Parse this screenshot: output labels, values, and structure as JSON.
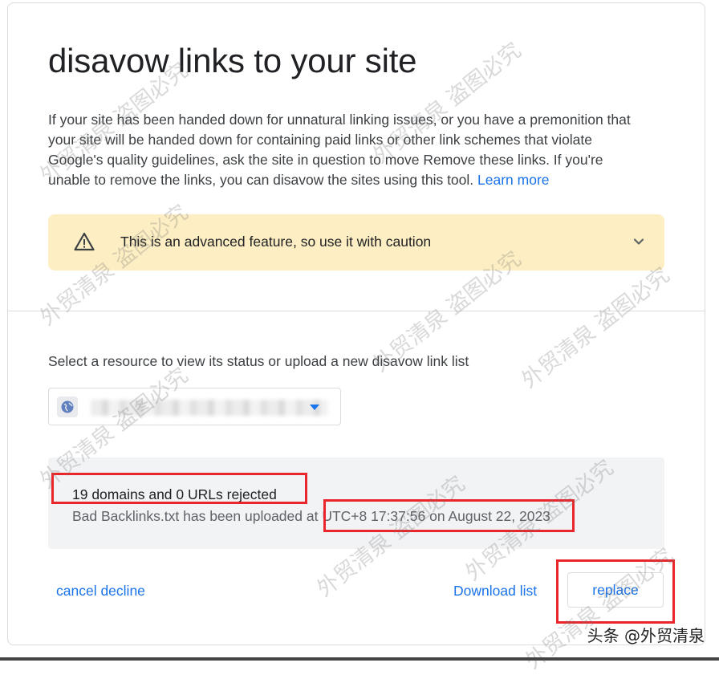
{
  "page": {
    "title": "disavow links to your site",
    "intro": "If your site has been handed down for unnatural linking issues, or you have a premonition that your site will be handed down for containing paid links or other link schemes that violate Google's quality guidelines, ask the site in question to move Remove these links. If you're unable to remove the links, you can disavow the sites using this tool.",
    "learn_more": "Learn more"
  },
  "warning": {
    "text": "This is an advanced feature, so use it with caution",
    "icon": "warning-triangle-icon",
    "toggle_icon": "chevron-down-icon"
  },
  "resource": {
    "label": "Select a resource to view its status or upload a new disavow link list",
    "selected_value": "",
    "icon": "globe-icon"
  },
  "status": {
    "main": "19 domains and 0 URLs rejected",
    "sub_prefix": "Bad Backlinks.txt has been uploaded at ",
    "sub_time": "UTC+8 17:37:56 on August 22, 2023"
  },
  "actions": {
    "cancel": "cancel decline",
    "download": "Download list",
    "replace": "replace"
  },
  "watermark": {
    "text": "外贸清泉 盗图必究",
    "brand": "头条 @外贸清泉"
  },
  "colors": {
    "accent": "#1a73e8",
    "warning_bg": "#fdefc3",
    "status_bg": "#f1f3f4",
    "highlight": "#e8262b"
  }
}
